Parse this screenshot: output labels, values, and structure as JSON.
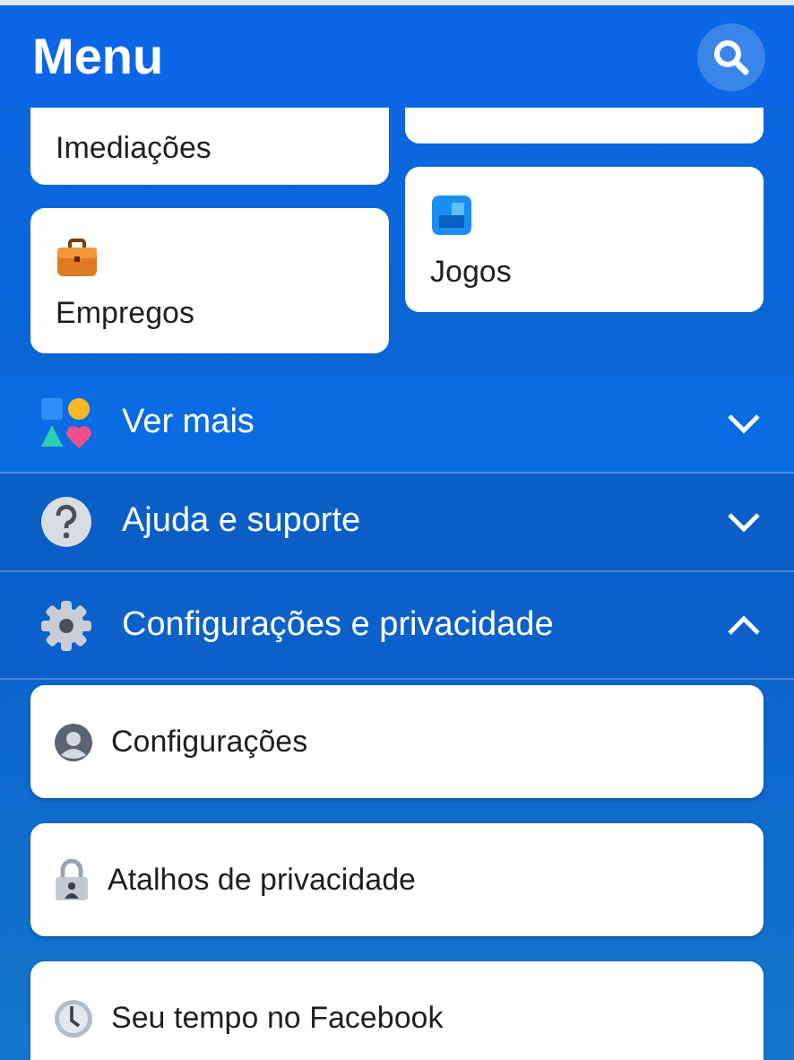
{
  "header": {
    "title": "Menu"
  },
  "shortcut_columns": [
    [
      {
        "label": "Imediações",
        "kind": "clipped"
      },
      {
        "label": "Empregos",
        "kind": "jobs"
      }
    ],
    [
      {
        "kind": "clipped"
      },
      {
        "label": "Jogos",
        "kind": "games"
      }
    ]
  ],
  "sections": [
    {
      "label": "Ver mais",
      "kind": "more",
      "expanded": false
    },
    {
      "label": "Ajuda e suporte",
      "kind": "help",
      "expanded": false
    },
    {
      "label": "Configurações e privacidade",
      "kind": "settings",
      "expanded": true
    }
  ],
  "settings_items": [
    {
      "label": "Configurações",
      "kind": "account"
    },
    {
      "label": "Atalhos de privacidade",
      "kind": "privacy"
    },
    {
      "label": "Seu tempo no Facebook",
      "kind": "time"
    }
  ]
}
